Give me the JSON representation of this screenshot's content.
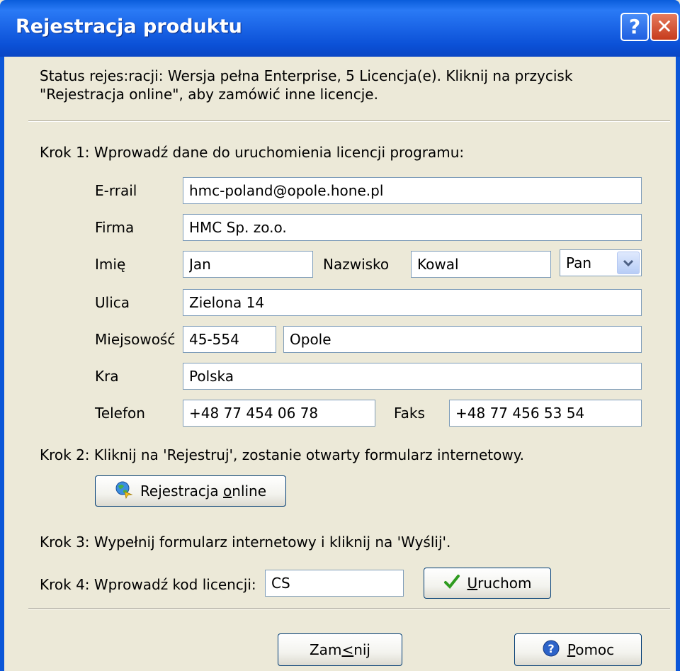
{
  "window": {
    "title": "Rejestracja produktu",
    "help_glyph": "?",
    "close_glyph": "✕"
  },
  "status": {
    "text": "Status rejes:racji: Wersja pełna Enterprise, 5 Licencja(e). Kliknij na przycisk \"Rejestracja online\", aby zamówić inne licencje."
  },
  "step1": {
    "text": "Krok 1: Wprowadź dane do uruchomienia licencji programu:",
    "fields": {
      "email_label": "E-rrail",
      "email_value": "hmc-poland@opole.hone.pl",
      "company_label": "Firma",
      "company_value": "HMC Sp. zo.o.",
      "firstname_label": "Imię",
      "firstname_value": "Jan",
      "lastname_label": "Nazwisko",
      "lastname_value": "Kowal",
      "salutation_value": "Pan",
      "street_label": "Ulica",
      "street_value": "Zielona 14",
      "city_label": "Miejsowość",
      "zip_value": "45-554",
      "city_value": "Opole",
      "country_label": "Kra",
      "country_value": "Polska",
      "phone_label": "Telefon",
      "phone_value": "+48 77 454 06 78",
      "fax_label": "Faks",
      "fax_value": "+48 77 456 53 54"
    }
  },
  "step2": {
    "text": "Krok 2: Kliknij na 'Rejestruj',  zostanie otwarty formularz internetowy.",
    "button_pre": "Rejestracja ",
    "button_key": "o",
    "button_post": "nline"
  },
  "step3": {
    "text": "Krok 3: Wypełnij formularz internetowy i kliknij na 'Wyślij'."
  },
  "step4": {
    "text": "Krok 4: Wprowadź kod licencji:",
    "code_value": "CS",
    "button_key": "U",
    "button_post": "ruchom"
  },
  "footer": {
    "close_pre": "Zam",
    "close_key": "<",
    "close_post": "nij",
    "help_key": "P",
    "help_post": "omoc"
  },
  "colors": {
    "titlebar": "#0a5ddb",
    "dialog_bg": "#ece9d8",
    "field_border": "#7f9db9"
  }
}
